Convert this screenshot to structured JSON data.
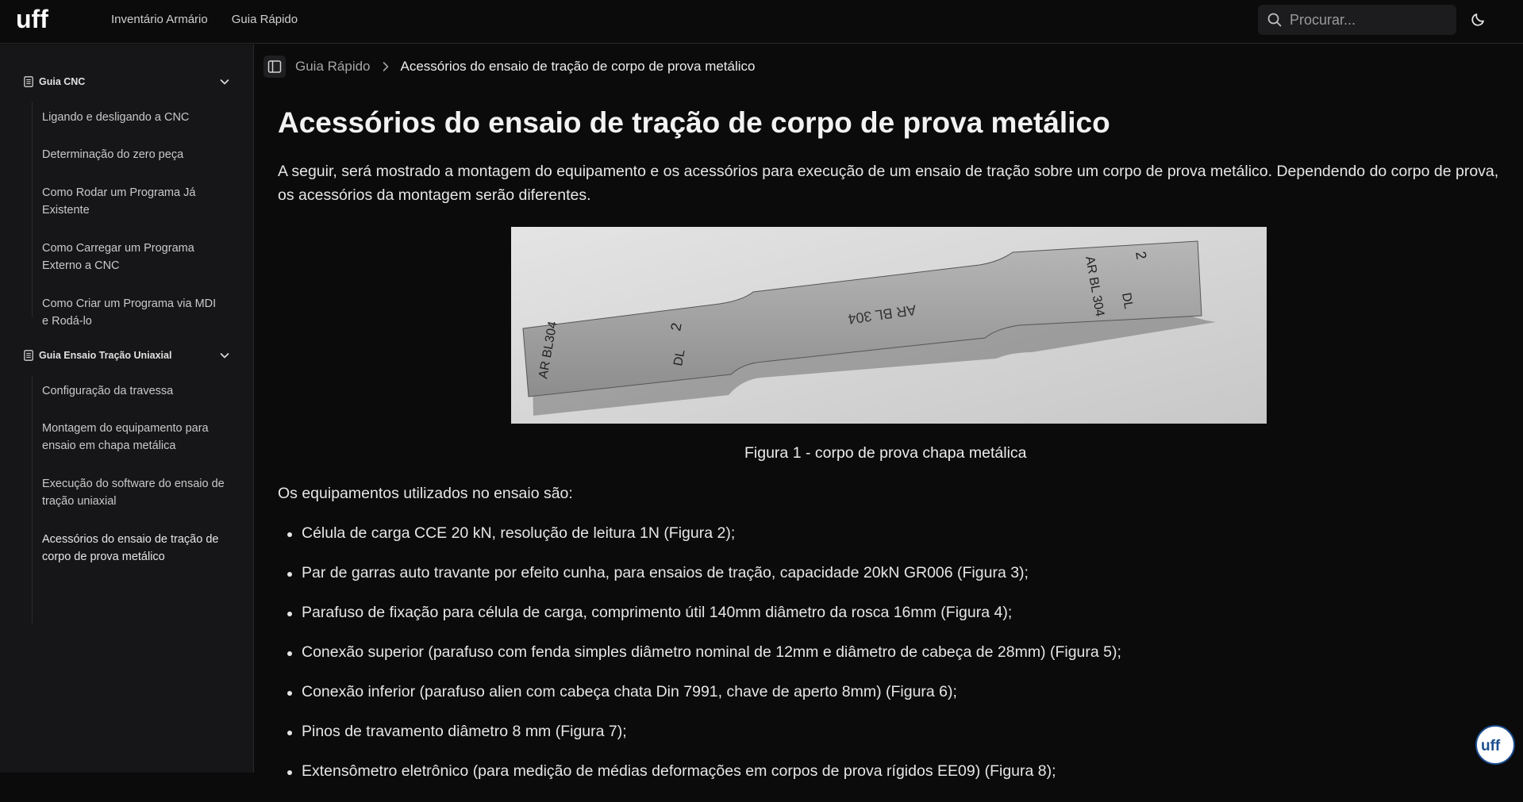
{
  "header": {
    "logo_text": "uff",
    "nav": [
      "Inventário Armário",
      "Guia Rápido"
    ],
    "search_placeholder": "Procurar..."
  },
  "sidebar": {
    "sections": [
      {
        "title": "Guia CNC",
        "items": [
          "Ligando e desligando a CNC",
          "Determinação do zero peça",
          "Como Rodar um Programa Já Existente",
          "Como Carregar um Programa Externo a CNC",
          "Como Criar um Programa via MDI e Rodá-lo"
        ]
      },
      {
        "title": "Guia Ensaio Tração Uniaxial",
        "items": [
          "Configuração da travessa",
          "Montagem do equipamento para ensaio em chapa metálica",
          "Execução do software do ensaio de tração uniaxial",
          "Acessórios do ensaio de tração de corpo de prova metálico"
        ]
      }
    ]
  },
  "breadcrumb": {
    "parent": "Guia Rápido",
    "current": "Acessórios do ensaio de tração de corpo de prova metálico"
  },
  "content": {
    "title": "Acessórios do ensaio de tração de corpo de prova metálico",
    "intro": "A seguir, será mostrado a montagem do equipamento e os acessórios para execução de um ensaio de tração sobre um corpo de prova metálico. Dependendo do corpo de prova, os acessórios da montagem serão diferentes.",
    "figure_caption": "Figura 1 - corpo de prova chapa metálica",
    "specimen_marks": {
      "left": [
        "2",
        "DL",
        "AR BL304"
      ],
      "middle": "AR BL 304",
      "right": [
        "2",
        "DL",
        "AR BL 304"
      ]
    },
    "list_lead": "Os equipamentos utilizados no ensaio são:",
    "equipment": [
      "Célula de carga CCE 20 kN, resolução de leitura 1N (Figura 2);",
      "Par de garras auto travante por efeito cunha, para ensaios de tração, capacidade 20kN GR006 (Figura 3);",
      "Parafuso de fixação para célula de carga, comprimento útil 140mm diâmetro da rosca 16mm (Figura 4);",
      "Conexão superior (parafuso com fenda simples diâmetro nominal de 12mm e diâmetro de cabeça de 28mm) (Figura 5);",
      "Conexão inferior (parafuso alien com cabeça chata Din 7991, chave de aperto 8mm) (Figura 6);",
      "Pinos de travamento diâmetro 8 mm (Figura 7);",
      "Extensômetro eletrônico (para medição de médias deformações em corpos de prova rígidos EE09) (Figura 8);"
    ]
  },
  "fab_label": "uff"
}
